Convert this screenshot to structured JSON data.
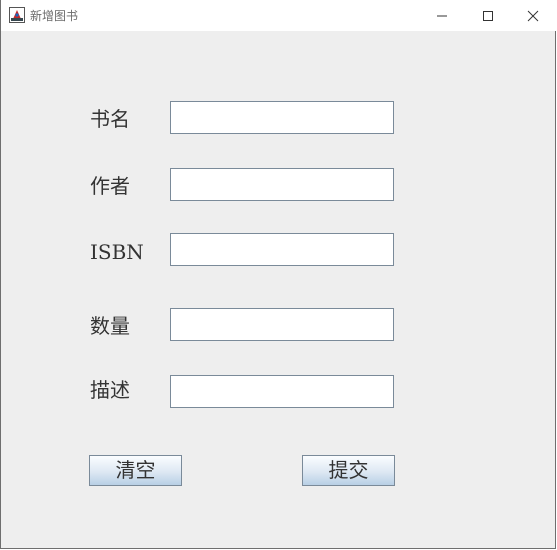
{
  "window": {
    "title": "新增图书"
  },
  "form": {
    "fields": [
      {
        "label": "书名",
        "value": ""
      },
      {
        "label": "作者",
        "value": ""
      },
      {
        "label": "ISBN",
        "value": ""
      },
      {
        "label": "数量",
        "value": ""
      },
      {
        "label": "描述",
        "value": ""
      }
    ]
  },
  "buttons": {
    "clear_label": "清空",
    "submit_label": "提交"
  },
  "colors": {
    "background": "#eeeeee",
    "field_border": "#7a8a99",
    "button_gradient_bottom": "#b8cfe5"
  }
}
